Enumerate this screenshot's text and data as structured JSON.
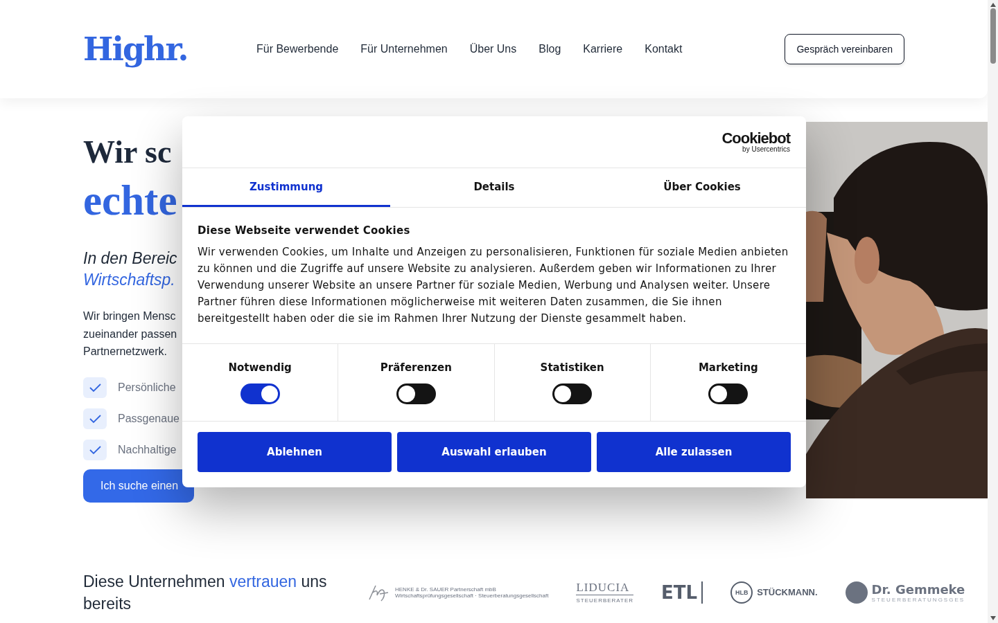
{
  "header": {
    "logo": "Highr.",
    "nav": [
      {
        "label": "Für Bewerbende"
      },
      {
        "label": "Für Unternehmen"
      },
      {
        "label": "Über Uns"
      },
      {
        "label": "Blog"
      },
      {
        "label": "Karriere"
      },
      {
        "label": "Kontakt"
      }
    ],
    "cta": "Gespräch vereinbaren"
  },
  "hero": {
    "headline": [
      {
        "text": "Wir sc",
        "highlight": false
      },
      {
        "text": "echte",
        "highlight": true
      }
    ],
    "subheading": [
      {
        "text": "In den Bereic",
        "highlight": false
      },
      {
        "text": "Wirtschaftsp.",
        "highlight": true
      }
    ],
    "paragraph": [
      "Wir bringen Mensc",
      "zueinander passen",
      "Partnernetzwerk."
    ],
    "checks": [
      {
        "label": "Persönliche"
      },
      {
        "label": "Passgenaue"
      },
      {
        "label": "Nachhaltige"
      }
    ],
    "button": "Ich suche einen",
    "photo": {
      "kind": "picture"
    }
  },
  "trust": {
    "title": [
      {
        "text": "Diese Unternehmen ",
        "highlight": false
      },
      {
        "text": "vertrauen",
        "highlight": true
      },
      {
        "text": " uns bereits",
        "highlight": false
      }
    ],
    "logos": [
      {
        "kind": "signature",
        "name": "HENKE & Dr. SAUER Partnerschaft mbB",
        "tagline": "Wirtschaftsprüfungsgesellschaft · Steuerberatungsgesellschaft"
      },
      {
        "kind": "serif",
        "name": "LIDUCIA",
        "tagline": "STEUERBERATER"
      },
      {
        "kind": "bar",
        "name": "ETL"
      },
      {
        "kind": "ring",
        "badge": "HLB",
        "name": "STÜCKMANN."
      },
      {
        "kind": "dot",
        "name": "Dr. Gemmeke",
        "tagline": "STEUERBERATUNGSGES"
      }
    ]
  },
  "cookie_dialog": {
    "brand": "Cookiebot",
    "brand_sub": "by Usercentrics",
    "tabs": [
      {
        "label": "Zustimmung",
        "selected": true
      },
      {
        "label": "Details",
        "selected": false
      },
      {
        "label": "Über Cookies",
        "selected": false
      }
    ],
    "title": "Diese Webseite verwendet Cookies",
    "body": "Wir verwenden Cookies, um Inhalte und Anzeigen zu personalisieren, Funktionen für soziale Medien anbieten zu können und die Zugriffe auf unsere Website zu analysieren. Außerdem geben wir Informationen zu Ihrer Verwendung unserer Website an unsere Partner für soziale Medien, Werbung und Analysen weiter. Unsere Partner führen diese Informationen möglicherweise mit weiteren Daten zusammen, die Sie ihnen bereitgestellt haben oder die sie im Rahmen Ihrer Nutzung der Dienste gesammelt haben.",
    "categories": [
      {
        "label": "Notwendig",
        "checked": true
      },
      {
        "label": "Präferenzen",
        "checked": false
      },
      {
        "label": "Statistiken",
        "checked": false
      },
      {
        "label": "Marketing",
        "checked": false
      }
    ],
    "buttons": [
      "Ablehnen",
      "Auswahl erlauben",
      "Alle zulassen"
    ]
  }
}
